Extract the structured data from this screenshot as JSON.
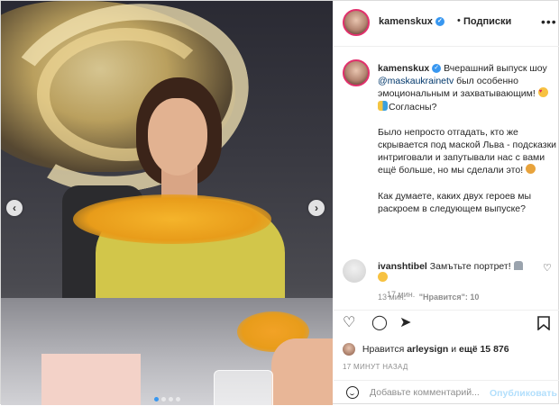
{
  "header": {
    "username": "kamenskux",
    "separator": "•",
    "follow_label": "Подписки",
    "more_icon": "more-horizontal-icon"
  },
  "caption": {
    "username": "kamenskux",
    "text_1": "Вчерашний выпуск шоу ",
    "mention": "@maskaukrainetv",
    "text_2": " был особенно эмоциональным и захватывающим! ",
    "text_3": "Согласны?",
    "para_2": "Было непросто отгадать, кто же скрывается под маской Льва - подсказки интриговали и запутывали нас с вами ещё больше, но мы сделали это! ",
    "para_3": "Как думаете, каких двух героев мы раскроем в следующем выпуске?",
    "time": "17 мин."
  },
  "comment": {
    "username": "ivanshtibel",
    "text": "Замътьте портрет!",
    "time": "13 мин.",
    "likes": "\"Нравится\": 10",
    "reply": "Ответить"
  },
  "likes": {
    "prefix": "Нравится",
    "user": "arleysign",
    "connector": "и",
    "others": "ещё 15 876"
  },
  "posted_ago": "17 МИНУТ НАЗАД",
  "add_comment": {
    "placeholder": "Добавьте комментарий...",
    "post_label": "Опубликовать"
  },
  "carousel": {
    "total": 4,
    "active": 1
  },
  "colors": {
    "verified": "#3897f0",
    "mention": "#00376b",
    "post_button": "#b2dffc"
  }
}
